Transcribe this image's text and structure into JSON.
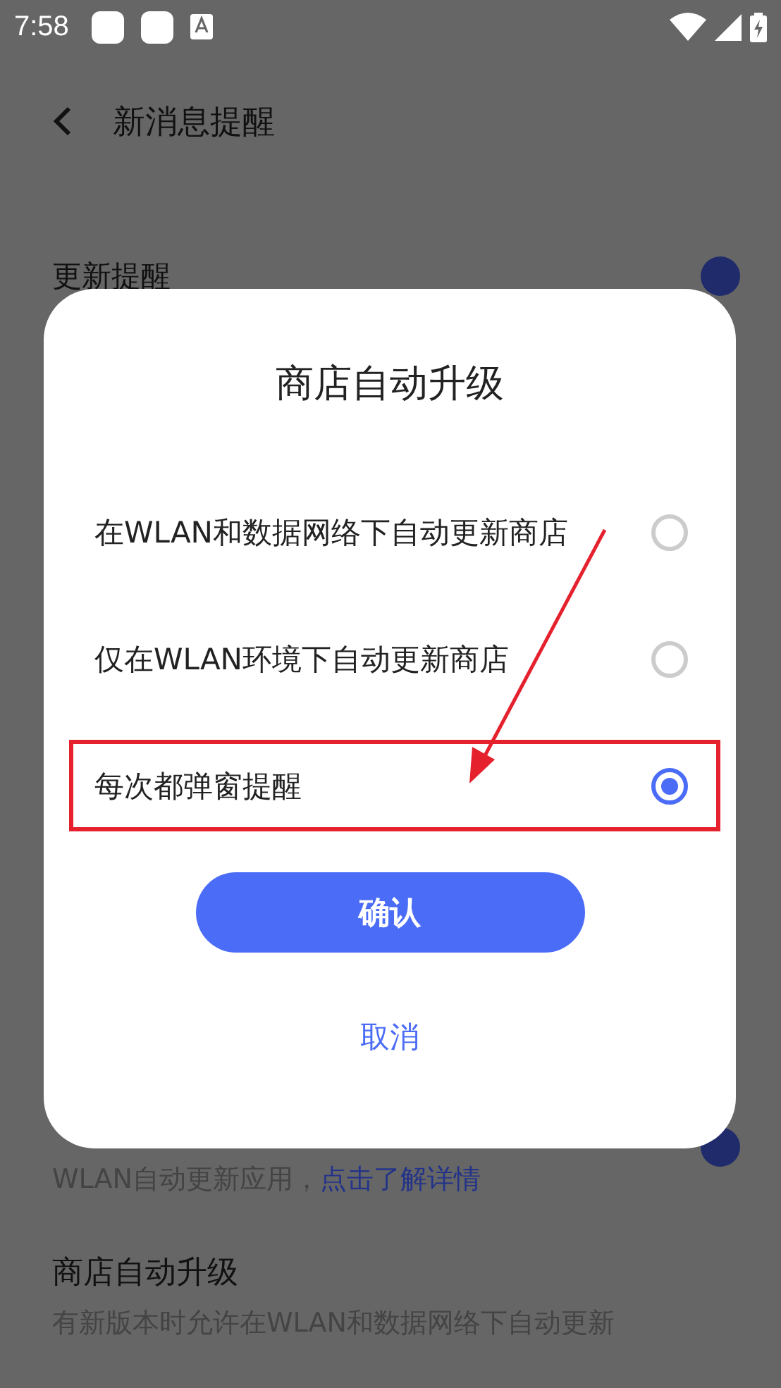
{
  "status_bar": {
    "time": "7:58"
  },
  "header": {
    "title": "新消息提醒"
  },
  "update_reminder": {
    "title": "更新提醒",
    "on": true
  },
  "auto_update": {
    "description": "WLAN自动更新应用，",
    "link": "点击了解详情",
    "on": true
  },
  "store_upgrade": {
    "title": "商店自动升级",
    "subtitle": "有新版本时允许在WLAN和数据网络下自动更新"
  },
  "dialog": {
    "title": "商店自动升级",
    "options": [
      {
        "label": "在WLAN和数据网络下自动更新商店",
        "selected": false,
        "highlighted": false
      },
      {
        "label": "仅在WLAN环境下自动更新商店",
        "selected": false,
        "highlighted": false
      },
      {
        "label": "每次都弹窗提醒",
        "selected": true,
        "highlighted": true
      }
    ],
    "confirm": "确认",
    "cancel": "取消"
  }
}
